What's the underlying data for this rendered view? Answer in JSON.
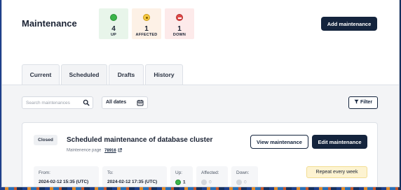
{
  "header": {
    "title": "Maintenance",
    "add_button": "Add maintenance",
    "stats": {
      "up": {
        "value": "4",
        "label": "UP"
      },
      "affected": {
        "value": "1",
        "label": "AFFECTED"
      },
      "down": {
        "value": "1",
        "label": "DOWN"
      }
    }
  },
  "tabs": [
    {
      "label": "Current"
    },
    {
      "label": "Scheduled"
    },
    {
      "label": "Drafts"
    },
    {
      "label": "History"
    }
  ],
  "toolbar": {
    "search_placeholder": "Search maintenances",
    "dates_label": "All dates",
    "filter_label": "Filter"
  },
  "card": {
    "status_badge": "Closed",
    "title": "Scheduled maintenance of database cluster",
    "maintenance_page_label": "Maintenence page",
    "maintenance_page_link": "78916",
    "view_button": "View maintenance",
    "edit_button": "Edit maintenance",
    "from": {
      "label": "From:",
      "value": "2024-02-12 15:35 (UTC)"
    },
    "to": {
      "label": "To:",
      "value": "2024-02-12 17:35 (UTC)"
    },
    "up": {
      "label": "Up:",
      "value": "1"
    },
    "affected": {
      "label": "Affected:",
      "value": "0"
    },
    "down": {
      "label": "Down:",
      "value": "0"
    },
    "repeat": "Repeat every week"
  },
  "colors": {
    "primary": "#14243d",
    "up_green": "#3bb54a",
    "affected_yellow": "#f5c842",
    "down_red": "#e04848"
  }
}
